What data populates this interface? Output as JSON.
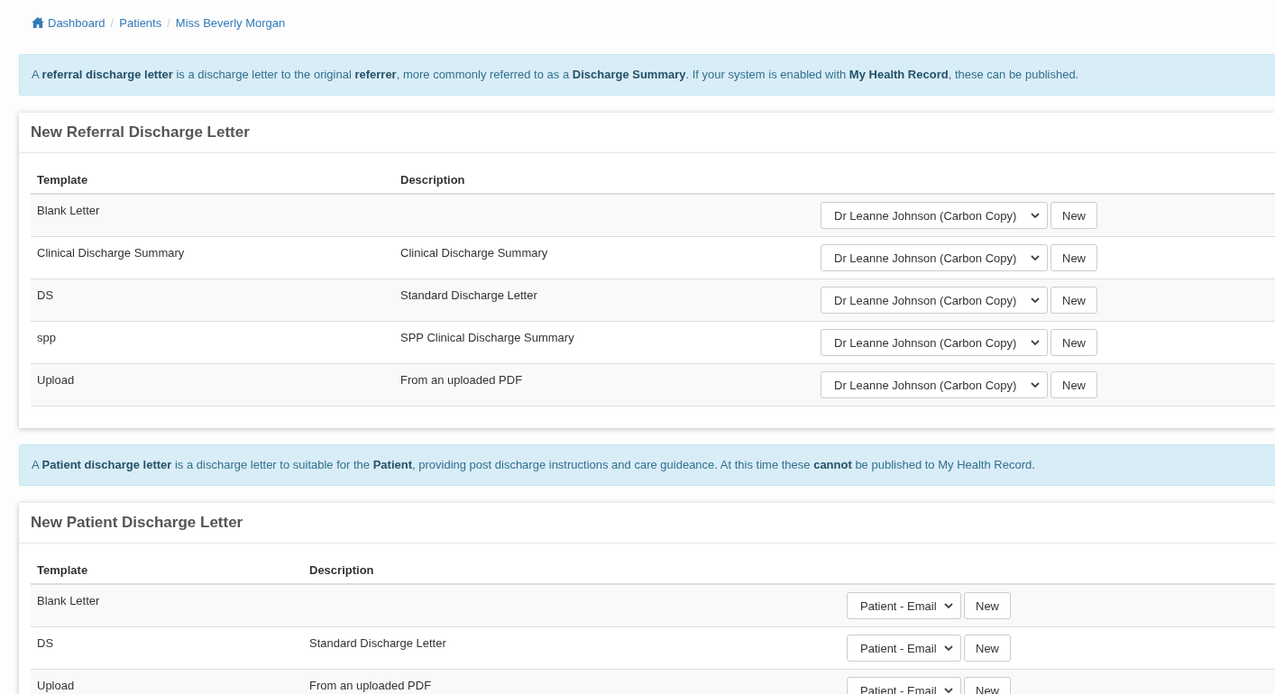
{
  "breadcrumb": [
    {
      "label": "Dashboard"
    },
    {
      "separator": "/",
      "label": "Patients"
    },
    {
      "separator": "/",
      "label": "Miss Beverly Morgan"
    }
  ],
  "sections": [
    {
      "alert": "A **referral discharge letter** is a discharge letter to the original **referrer**, more commonly referred to as a **Discharge Summary**. If your system is enabled with **My Health Record**, these can be published.",
      "card": {
        "title": "New Referral Discharge Letter",
        "columns": [
          "Template",
          "Description"
        ],
        "rows": [
          {
            "template": "Blank Letter",
            "recipient": "Dr Leanne Johnson (Carbon Copy)",
            "button": "New"
          },
          {
            "template": "Clinical Discharge Summary",
            "description": "Clinical Discharge Summary",
            "recipient": "Dr Leanne Johnson (Carbon Copy)",
            "button": "New"
          },
          {
            "template": "DS",
            "description": "Standard Discharge Letter",
            "recipient": "Dr Leanne Johnson (Carbon Copy)",
            "button": "New"
          },
          {
            "template": "spp",
            "description": "SPP Clinical Discharge Summary",
            "recipient": "Dr Leanne Johnson (Carbon Copy)",
            "button": "New"
          },
          {
            "template": "Upload",
            "description": "From an uploaded PDF",
            "recipient": "Dr Leanne Johnson (Carbon Copy)",
            "button": "New"
          }
        ]
      }
    },
    {
      "alert": "A **Patient discharge letter** is a discharge letter to suitable for the **Patient**, providing post discharge instructions and care guideance. At this time these **cannot** be published to My Health Record.",
      "card": {
        "title": "New Patient Discharge Letter",
        "columns": [
          "Template",
          "Description"
        ],
        "rows": [
          {
            "template": "Blank Letter",
            "recipient": "Patient - Email",
            "button": "New"
          },
          {
            "template": "DS",
            "description": "Standard Discharge Letter",
            "recipient": "Patient - Email",
            "button": "New"
          },
          {
            "template": "Upload",
            "description": "From an uploaded PDF",
            "recipient": "Patient - Email",
            "button": "New"
          }
        ]
      }
    }
  ]
}
